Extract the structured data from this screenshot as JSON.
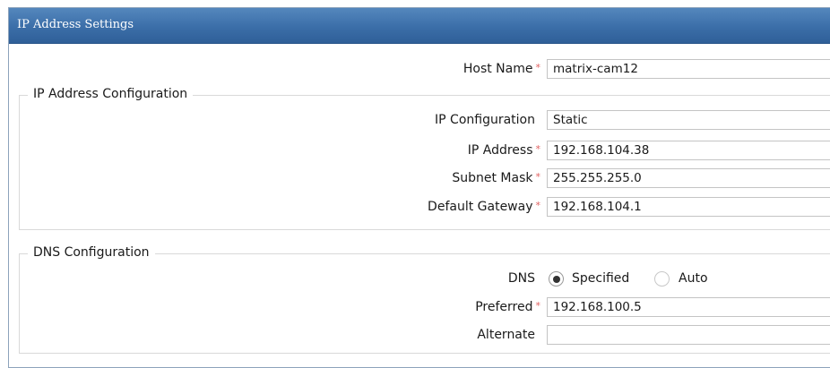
{
  "window": {
    "title": "IP Address Settings"
  },
  "host": {
    "label": "Host Name",
    "value": "matrix-cam12",
    "required_mark": "*"
  },
  "ip_section": {
    "legend": "IP Address Configuration",
    "ip_configuration": {
      "label": "IP Configuration",
      "value": "Static"
    },
    "ip_address": {
      "label": "IP Address",
      "value": "192.168.104.38",
      "required_mark": "*"
    },
    "subnet_mask": {
      "label": "Subnet Mask",
      "value": "255.255.255.0",
      "required_mark": "*"
    },
    "default_gateway": {
      "label": "Default Gateway",
      "value": "192.168.104.1",
      "required_mark": "*"
    }
  },
  "dns_section": {
    "legend": "DNS Configuration",
    "dns": {
      "label": "DNS",
      "options": [
        "Specified",
        "Auto"
      ],
      "selected": "Specified"
    },
    "preferred": {
      "label": "Preferred",
      "value": "192.168.100.5",
      "required_mark": "*"
    },
    "alternate": {
      "label": "Alternate",
      "value": ""
    }
  },
  "colors": {
    "title_bar": "#3b6ea8",
    "required_mark": "#e06060"
  }
}
